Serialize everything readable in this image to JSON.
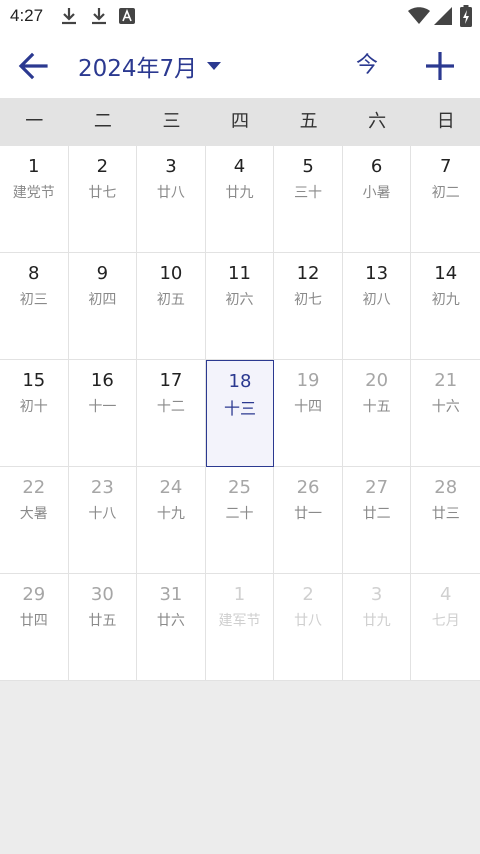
{
  "statusbar": {
    "time": "4:27",
    "icons": [
      "download-icon",
      "download-icon",
      "app-notification-icon",
      "wifi-icon",
      "signal-icon",
      "battery-charging-icon"
    ]
  },
  "header": {
    "title": "2024年7月",
    "today_label": "今",
    "accent_color": "#2b3990"
  },
  "weekdays": [
    "一",
    "二",
    "三",
    "四",
    "五",
    "六",
    "日"
  ],
  "days": [
    {
      "day": "1",
      "lunar": "建党节",
      "state": "past"
    },
    {
      "day": "2",
      "lunar": "廿七",
      "state": "past"
    },
    {
      "day": "3",
      "lunar": "廿八",
      "state": "past"
    },
    {
      "day": "4",
      "lunar": "廿九",
      "state": "past"
    },
    {
      "day": "5",
      "lunar": "三十",
      "state": "past"
    },
    {
      "day": "6",
      "lunar": "小暑",
      "state": "past"
    },
    {
      "day": "7",
      "lunar": "初二",
      "state": "past"
    },
    {
      "day": "8",
      "lunar": "初三",
      "state": "past"
    },
    {
      "day": "9",
      "lunar": "初四",
      "state": "past"
    },
    {
      "day": "10",
      "lunar": "初五",
      "state": "past"
    },
    {
      "day": "11",
      "lunar": "初六",
      "state": "past"
    },
    {
      "day": "12",
      "lunar": "初七",
      "state": "past"
    },
    {
      "day": "13",
      "lunar": "初八",
      "state": "past"
    },
    {
      "day": "14",
      "lunar": "初九",
      "state": "past"
    },
    {
      "day": "15",
      "lunar": "初十",
      "state": "past"
    },
    {
      "day": "16",
      "lunar": "十一",
      "state": "past"
    },
    {
      "day": "17",
      "lunar": "十二",
      "state": "past"
    },
    {
      "day": "18",
      "lunar": "十三",
      "state": "selected"
    },
    {
      "day": "19",
      "lunar": "十四",
      "state": "future"
    },
    {
      "day": "20",
      "lunar": "十五",
      "state": "future"
    },
    {
      "day": "21",
      "lunar": "十六",
      "state": "future"
    },
    {
      "day": "22",
      "lunar": "大暑",
      "state": "future"
    },
    {
      "day": "23",
      "lunar": "十八",
      "state": "future"
    },
    {
      "day": "24",
      "lunar": "十九",
      "state": "future"
    },
    {
      "day": "25",
      "lunar": "二十",
      "state": "future"
    },
    {
      "day": "26",
      "lunar": "廿一",
      "state": "future"
    },
    {
      "day": "27",
      "lunar": "廿二",
      "state": "future"
    },
    {
      "day": "28",
      "lunar": "廿三",
      "state": "future"
    },
    {
      "day": "29",
      "lunar": "廿四",
      "state": "future"
    },
    {
      "day": "30",
      "lunar": "廿五",
      "state": "future"
    },
    {
      "day": "31",
      "lunar": "廿六",
      "state": "future"
    },
    {
      "day": "1",
      "lunar": "建军节",
      "state": "other"
    },
    {
      "day": "2",
      "lunar": "廿八",
      "state": "other"
    },
    {
      "day": "3",
      "lunar": "廿九",
      "state": "other"
    },
    {
      "day": "4",
      "lunar": "七月",
      "state": "other"
    }
  ]
}
